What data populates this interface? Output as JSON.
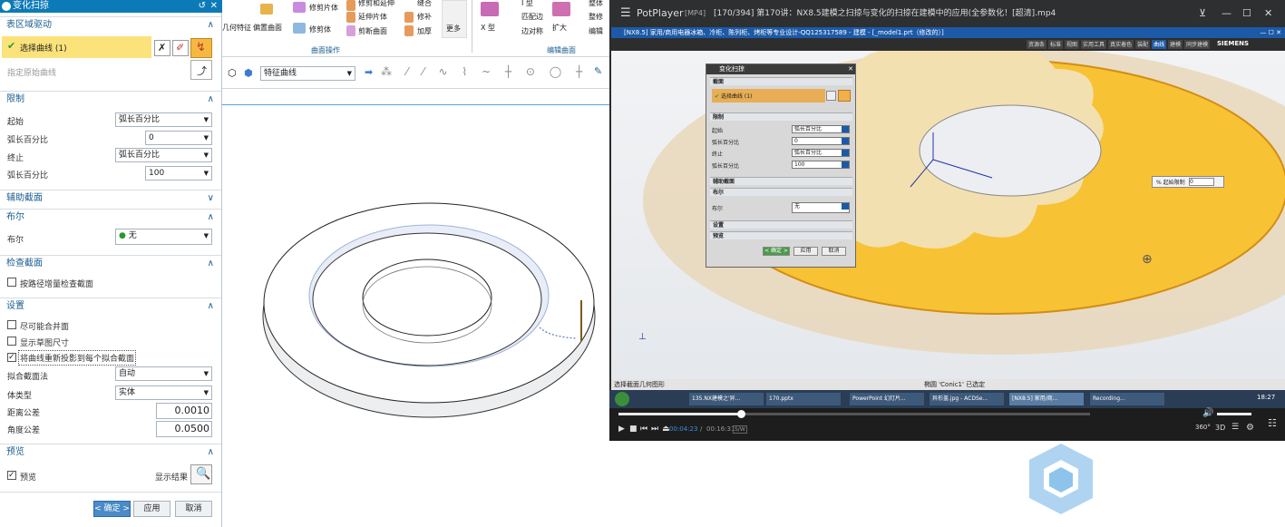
{
  "dialog": {
    "title": "变化扫掠",
    "section_table_drive": "表区域驱动",
    "select_curve": "选择曲线 (1)",
    "specify_origin_curve": "指定原始曲线",
    "section_limits": "限制",
    "start_label": "起始",
    "start_value": "弧长百分比",
    "arc_pct_label_1": "弧长百分比",
    "arc_pct_value_1": "0",
    "end_label": "终止",
    "end_value": "弧长百分比",
    "arc_pct_label_2": "弧长百分比",
    "arc_pct_value_2": "100",
    "section_aux": "辅助截面",
    "section_boolean": "布尔",
    "boolean_label": "布尔",
    "boolean_value": "无",
    "section_check": "检查截面",
    "check_increment": "按路径增量检查截面",
    "section_settings": "设置",
    "merge_faces": "尽可能合并面",
    "show_sketch_dims": "显示草图尺寸",
    "reproject": "将曲线重新投影到每个拟合截面",
    "fit_method_label": "拟合截面法",
    "fit_method_value": "自动",
    "body_type_label": "体类型",
    "body_type_value": "实体",
    "dist_tol_label": "距离公差",
    "dist_tol_value": "0.0010",
    "angle_tol_label": "角度公差",
    "angle_tol_value": "0.0500",
    "section_preview": "预览",
    "preview_label": "预览",
    "show_result": "显示结果",
    "ok": "< 确定 >",
    "apply": "应用",
    "cancel": "取消"
  },
  "cad_toolbar": {
    "items": [
      "修剪片体",
      "修剪和延伸",
      "缝合",
      "延伸片体",
      "修补",
      "剪断曲面",
      "加厚",
      "更多",
      "X 型",
      "I 型",
      "匹配边",
      "边对称",
      "扩大",
      "整体",
      "整修",
      "编辑"
    ],
    "left_items": [
      "偏置曲面",
      "修剪体"
    ],
    "left_partial": "几何特征",
    "group_surface_ops": "曲面操作",
    "group_edit_surface": "编辑曲面",
    "filter_value": "特征曲线"
  },
  "potplayer": {
    "app": "PotPlayer",
    "format": "[MP4]",
    "title": "[170/394] 第170讲：NX8.5建模之扫掠与变化的扫掠在建模中的应用(全参数化！[超清].mp4",
    "nx_title": "[NX8.5] 家用/商用电器冰箱、冷柜、陈列柜、烤柜等专业设计-QQ125317589 - 建模 - [_model1.prt（修改的）]",
    "siemens": "SIEMENS",
    "tabs": [
      "资源条",
      "标准",
      "视图",
      "实用工具",
      "真实着色",
      "装配",
      "曲线",
      "建模",
      "同步建模"
    ],
    "inner_dialog": {
      "title": "变化扫掠",
      "sec1": "截面",
      "select": "选择曲线 (1)",
      "sec2": "限制",
      "start": "起始",
      "start_val": "弧长百分比",
      "pct1": "弧长百分比",
      "pct1_val": "0",
      "end": "终止",
      "end_val": "弧长百分比",
      "pct2": "弧长百分比",
      "pct2_val": "100",
      "sec3": "辅助截面",
      "sec4": "布尔",
      "bool": "布尔",
      "bool_val": "无",
      "sec5": "设置",
      "sec6": "预览",
      "ok": "< 确定 >",
      "apply": "应用",
      "cancel": "取消"
    },
    "floating_label": "% 起始限制",
    "floating_value": "0",
    "status_left": "选择截面几何图形",
    "status_mid": "椭圆 'Conic1' 已选定",
    "taskbar_items": [
      "135.NX建模之'异...",
      "170.pptx",
      "PowerPoint 幻灯片...",
      "异形盖.jpg - ACDSe...",
      "[NX8.5] 家用/商...",
      "Recording..."
    ],
    "clock": "18:27",
    "time_current": "00:04:23",
    "time_total": "00:16:31",
    "sw": "S/W",
    "progress": 0.26,
    "btn_360": "360°",
    "btn_3d": "3D"
  }
}
